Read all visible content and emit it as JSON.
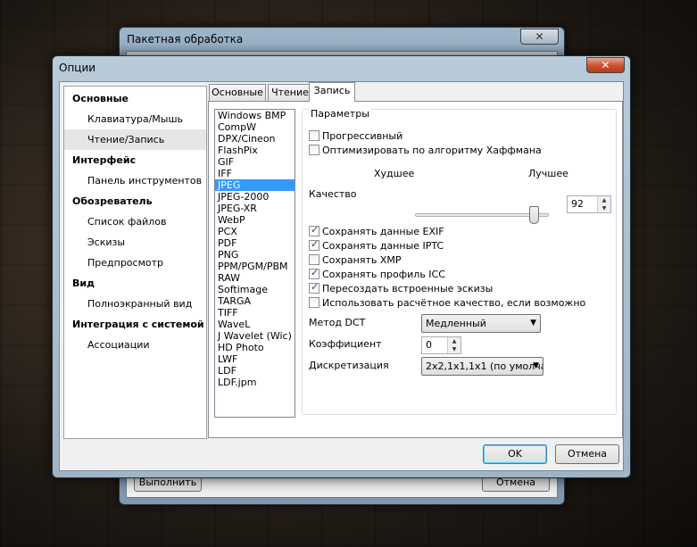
{
  "back_window": {
    "title": "Пакетная обработка",
    "close_glyph": "✕",
    "run_label": "Выполнить",
    "cancel_label": "Отмена"
  },
  "window": {
    "title": "Опции",
    "close_glyph": "✕"
  },
  "nav": {
    "items": [
      {
        "label": "Основные",
        "type": "header"
      },
      {
        "label": "Клавиатура/Мышь",
        "type": "sub"
      },
      {
        "label": "Чтение/Запись",
        "type": "sub",
        "selected": true
      },
      {
        "label": "Интерфейс",
        "type": "header"
      },
      {
        "label": "Панель инструментов",
        "type": "sub"
      },
      {
        "label": "Обозреватель",
        "type": "header"
      },
      {
        "label": "Список файлов",
        "type": "sub"
      },
      {
        "label": "Эскизы",
        "type": "sub"
      },
      {
        "label": "Предпросмотр",
        "type": "sub"
      },
      {
        "label": "Вид",
        "type": "header"
      },
      {
        "label": "Полноэкранный вид",
        "type": "sub"
      },
      {
        "label": "Интеграция с системой",
        "type": "header"
      },
      {
        "label": "Ассоциации",
        "type": "sub"
      }
    ]
  },
  "tabs": [
    "Основные",
    "Чтение",
    "Запись"
  ],
  "active_tab": "Запись",
  "formats": [
    "Windows BMP",
    "CompW",
    "DPX/Cineon",
    "FlashPix",
    "GIF",
    "IFF",
    "JPEG",
    "JPEG-2000",
    "JPEG-XR",
    "WebP",
    "PCX",
    "PDF",
    "PNG",
    "PPM/PGM/PBM",
    "RAW",
    "Softimage",
    "TARGA",
    "TIFF",
    "WaveL",
    "J Wavelet (Wic)",
    "HD Photo",
    "LWF",
    "LDF",
    "LDF.jpm"
  ],
  "selected_format": "JPEG",
  "params": {
    "group_label": "Параметры",
    "progressive": {
      "label": "Прогрессивный",
      "checked": false
    },
    "huffman": {
      "label": "Оптимизировать по алгоритму Хаффмана",
      "checked": false
    },
    "quality_label": "Качество",
    "worst_label": "Худшее",
    "best_label": "Лучшее",
    "quality_value": "92",
    "quality_fraction": 0.92,
    "exif": {
      "label": "Сохранять данные EXIF",
      "checked": true
    },
    "iptc": {
      "label": "Сохранять данные IPTC",
      "checked": true
    },
    "xmp": {
      "label": "Сохранять XMP",
      "checked": false
    },
    "icc": {
      "label": "Сохранять профиль ICC",
      "checked": true
    },
    "thumbs": {
      "label": "Пересоздать встроенные эскизы",
      "checked": true
    },
    "source_quality": {
      "label": "Использовать расчётное качество, если возможно",
      "checked": false
    },
    "dct_label": "Метод DCT",
    "dct_value": "Медленный",
    "coef_label": "Коэффициент",
    "coef_value": "0",
    "sampling_label": "Дискретизация",
    "sampling_value": "2x2,1x1,1x1 (по умолча"
  },
  "buttons": {
    "ok": "OK",
    "cancel": "Отмена"
  }
}
